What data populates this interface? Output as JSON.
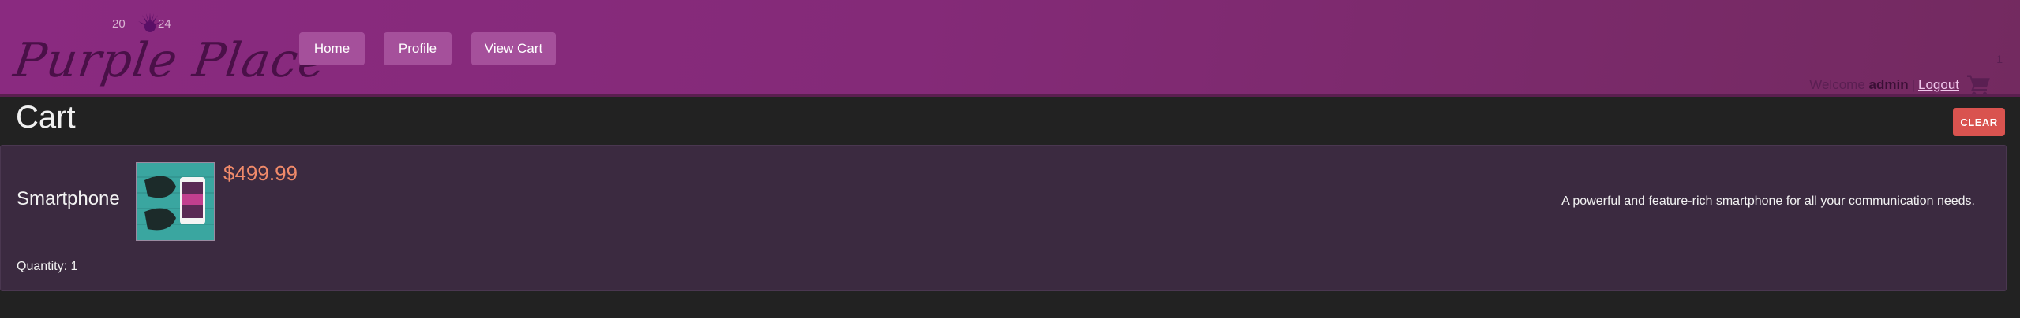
{
  "header": {
    "logo": {
      "text": "Purple Place",
      "year_left": "20",
      "year_right": "24"
    },
    "nav": [
      {
        "label": "Home"
      },
      {
        "label": "Profile"
      },
      {
        "label": "View Cart"
      }
    ],
    "user": {
      "welcome_prefix": "Welcome",
      "username": "admin",
      "separator": "|",
      "logout_label": "Logout"
    },
    "cart_count": "1",
    "icons": {
      "cart": "cart-icon",
      "logo_burst": "sunburst-icon"
    }
  },
  "page": {
    "title": "Cart",
    "clear_label": "CLEAR"
  },
  "cart": {
    "items": [
      {
        "name": "Smartphone",
        "price": "$499.99",
        "description": "A powerful and feature-rich smartphone for all your communication needs.",
        "quantity_label": "Quantity:",
        "quantity": "1"
      }
    ]
  },
  "colors": {
    "header_bg": "#852a7a",
    "nav_button": "#a5509b",
    "page_bg": "#222222",
    "card_bg": "#3b2a40",
    "price": "#f08a6a",
    "clear_button": "#d9534f"
  }
}
